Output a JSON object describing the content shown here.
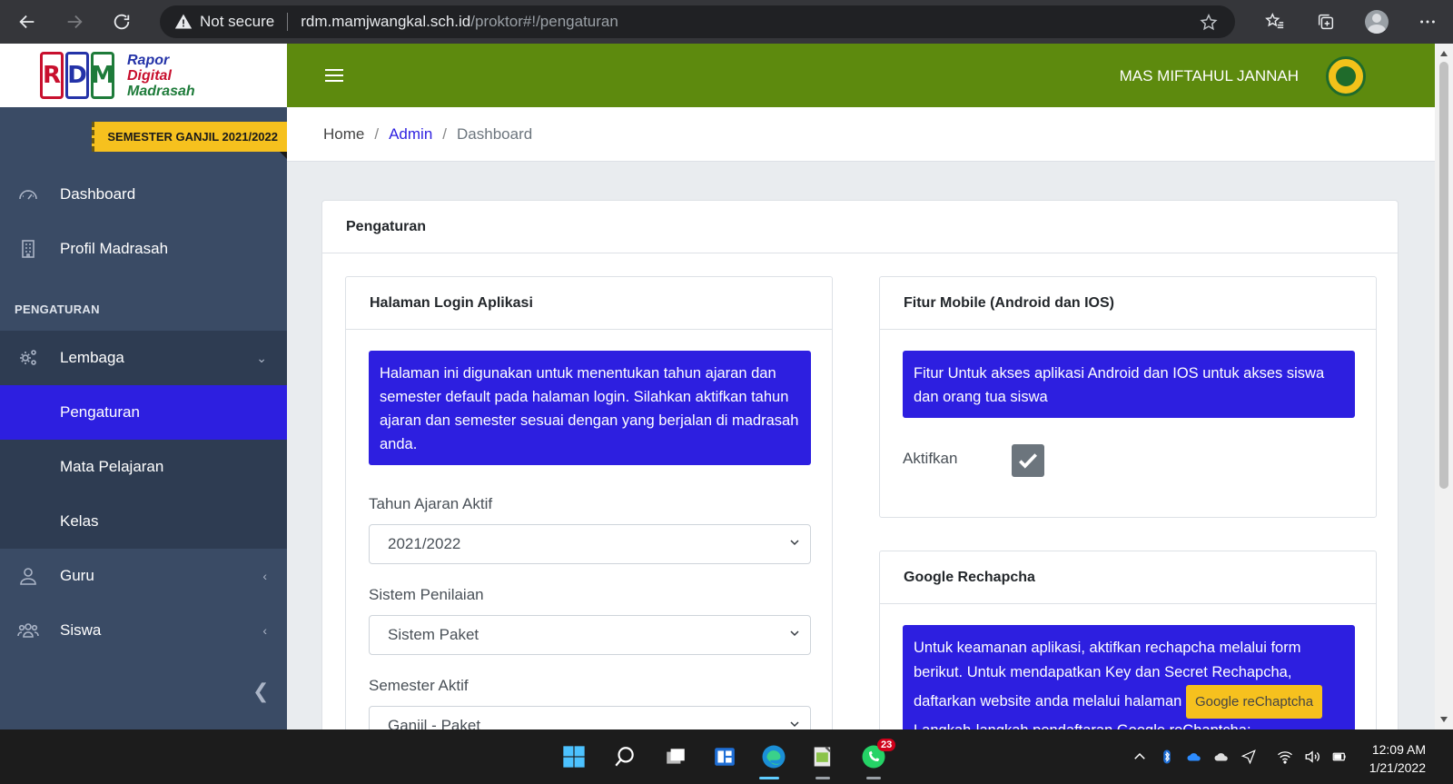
{
  "browser": {
    "security_label": "Not secure",
    "url_host": "rdm.mamjwangkal.sch.id",
    "url_path": "/proktor#!/pengaturan"
  },
  "brand": {
    "logo_letters": [
      "R",
      "D",
      "M"
    ],
    "line1": "Rapor",
    "line2": "Digital",
    "line3": "Madrasah"
  },
  "semester_badge": "SEMESTER GANJIL 2021/2022",
  "sidebar": {
    "items": [
      {
        "label": "Dashboard",
        "icon": "dashboard-icon"
      },
      {
        "label": "Profil Madrasah",
        "icon": "building-icon"
      }
    ],
    "section_label": "PENGATURAN",
    "lembaga": {
      "label": "Lembaga",
      "icon": "gears-icon"
    },
    "submenu": [
      "Pengaturan",
      "Mata Pelajaran",
      "Kelas"
    ],
    "guru": {
      "label": "Guru",
      "icon": "user-icon"
    },
    "siswa": {
      "label": "Siswa",
      "icon": "users-icon"
    }
  },
  "topbar": {
    "user_name": "MAS MIFTAHUL JANNAH"
  },
  "breadcrumb": {
    "home": "Home",
    "admin": "Admin",
    "current": "Dashboard",
    "separator": "/"
  },
  "main": {
    "title": "Pengaturan",
    "login_card": {
      "title": "Halaman Login Aplikasi",
      "info": "Halaman ini digunakan untuk menentukan tahun ajaran dan semester default pada halaman login. Silahkan aktifkan tahun ajaran dan semester sesuai dengan yang berjalan di madrasah anda.",
      "tahun_label": "Tahun Ajaran Aktif",
      "tahun_value": "2021/2022",
      "sistem_label": "Sistem Penilaian",
      "sistem_value": "Sistem Paket",
      "semester_label": "Semester Aktif",
      "semester_value": "Ganjil - Paket"
    },
    "mobile_card": {
      "title": "Fitur Mobile (Android dan IOS)",
      "info": "Fitur Untuk akses aplikasi Android dan IOS untuk akses siswa dan orang tua siswa",
      "toggle_label": "Aktifkan",
      "checked": true
    },
    "captcha_card": {
      "title": "Google Rechapcha",
      "info": "Untuk keamanan aplikasi, aktifkan rechapcha melalui form berikut. Untuk mendapatkan Key dan Secret Rechapcha, daftarkan website anda melalui halaman",
      "button": "Google reChaptcha",
      "info2": "Langkah-langkah pendaftaran Google reChaptcha:"
    }
  },
  "taskbar": {
    "whatsapp_badge": "23",
    "time": "12:09 AM",
    "date": "1/21/2022"
  },
  "colors": {
    "sidebar": "#3a4b65",
    "topbar": "#5d8a0e",
    "accent": "#2d1fe0",
    "badge": "#f6c11e"
  }
}
